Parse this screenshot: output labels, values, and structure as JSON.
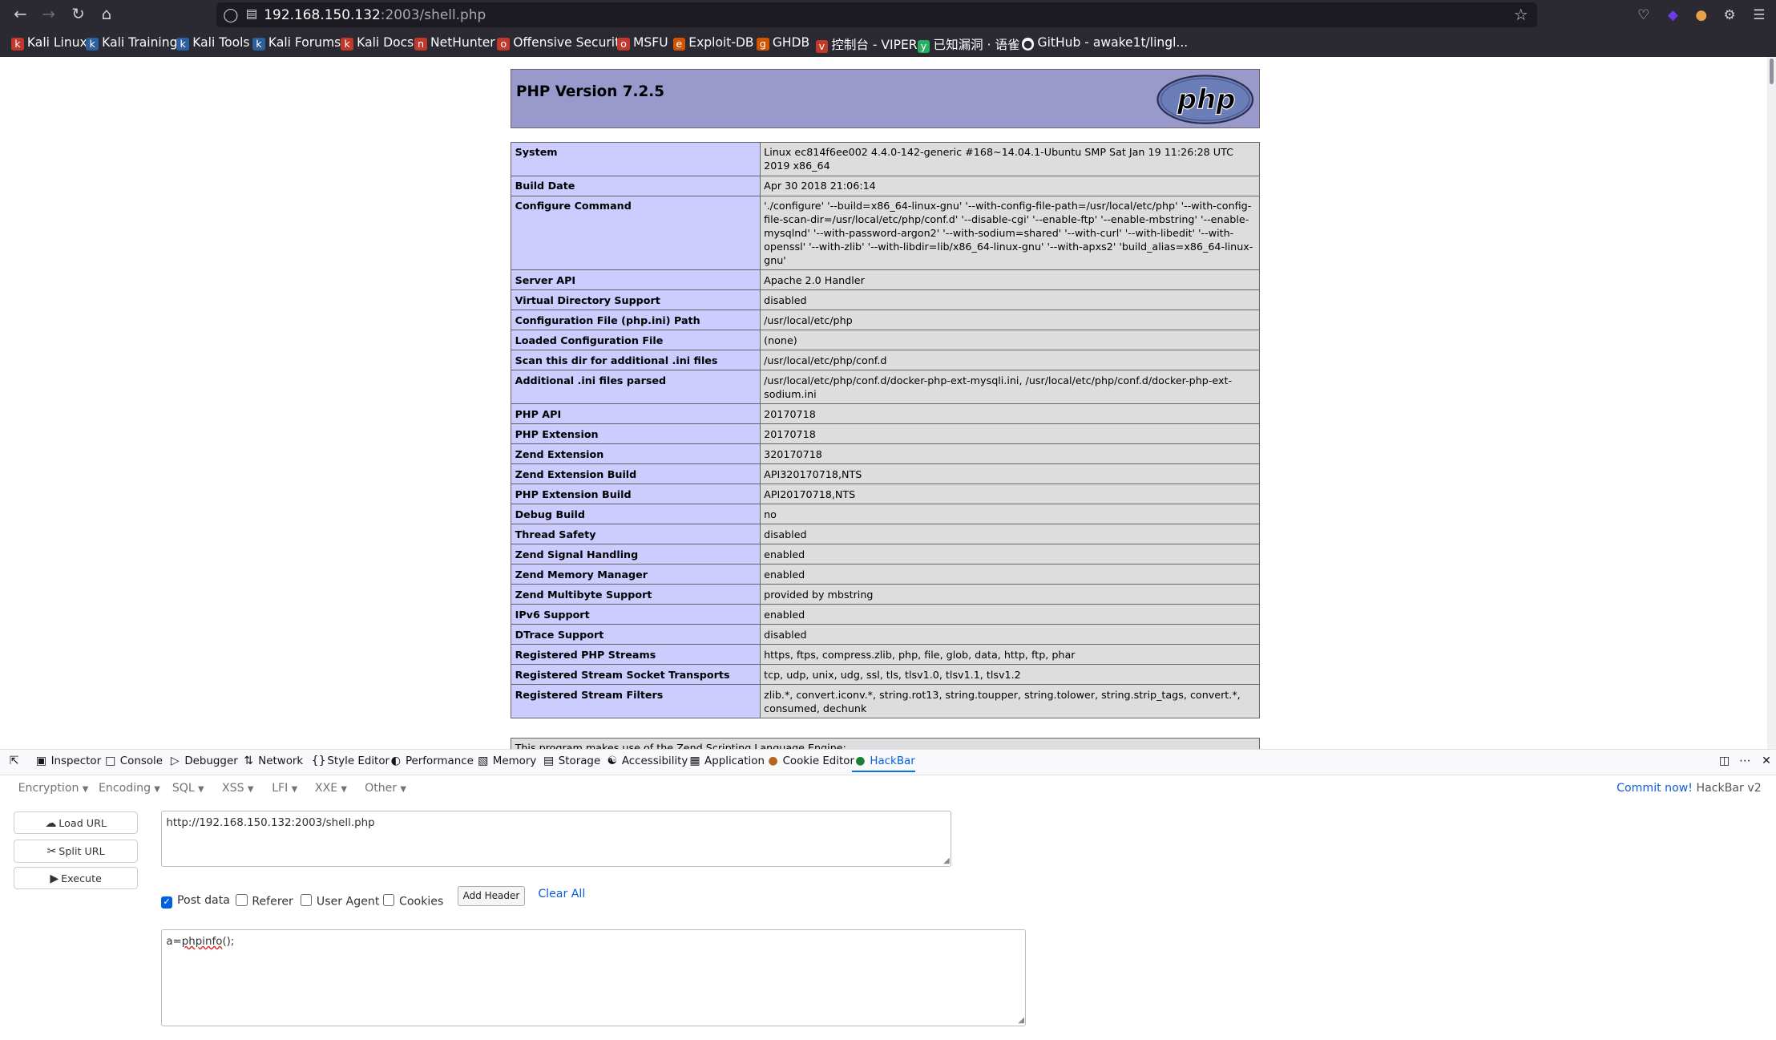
{
  "browser": {
    "url_host": "192.168.150.132",
    "url_path": ":2003/shell.php"
  },
  "bookmarks": [
    {
      "label": "Kali Linux"
    },
    {
      "label": "Kali Training"
    },
    {
      "label": "Kali Tools"
    },
    {
      "label": "Kali Forums"
    },
    {
      "label": "Kali Docs"
    },
    {
      "label": "NetHunter"
    },
    {
      "label": "Offensive Security"
    },
    {
      "label": "MSFU"
    },
    {
      "label": "Exploit-DB"
    },
    {
      "label": "GHDB"
    },
    {
      "label": "控制台 - VIPER"
    },
    {
      "label": "已知漏洞 · 语雀"
    },
    {
      "label": "GitHub - awake1t/lingl..."
    }
  ],
  "phpinfo": {
    "title": "PHP Version 7.2.5",
    "logo_text": "php",
    "rows": [
      {
        "k": "System",
        "v": "Linux ec814f6ee002 4.4.0-142-generic #168~14.04.1-Ubuntu SMP Sat Jan 19 11:26:28 UTC 2019 x86_64"
      },
      {
        "k": "Build Date",
        "v": "Apr 30 2018 21:06:14"
      },
      {
        "k": "Configure Command",
        "v": "'./configure' '--build=x86_64-linux-gnu' '--with-config-file-path=/usr/local/etc/php' '--with-config-file-scan-dir=/usr/local/etc/php/conf.d' '--disable-cgi' '--enable-ftp' '--enable-mbstring' '--enable-mysqlnd' '--with-password-argon2' '--with-sodium=shared' '--with-curl' '--with-libedit' '--with-openssl' '--with-zlib' '--with-libdir=lib/x86_64-linux-gnu' '--with-apxs2' 'build_alias=x86_64-linux-gnu'"
      },
      {
        "k": "Server API",
        "v": "Apache 2.0 Handler"
      },
      {
        "k": "Virtual Directory Support",
        "v": "disabled"
      },
      {
        "k": "Configuration File (php.ini) Path",
        "v": "/usr/local/etc/php"
      },
      {
        "k": "Loaded Configuration File",
        "v": "(none)"
      },
      {
        "k": "Scan this dir for additional .ini files",
        "v": "/usr/local/etc/php/conf.d"
      },
      {
        "k": "Additional .ini files parsed",
        "v": "/usr/local/etc/php/conf.d/docker-php-ext-mysqli.ini, /usr/local/etc/php/conf.d/docker-php-ext-sodium.ini"
      },
      {
        "k": "PHP API",
        "v": "20170718"
      },
      {
        "k": "PHP Extension",
        "v": "20170718"
      },
      {
        "k": "Zend Extension",
        "v": "320170718"
      },
      {
        "k": "Zend Extension Build",
        "v": "API320170718,NTS"
      },
      {
        "k": "PHP Extension Build",
        "v": "API20170718,NTS"
      },
      {
        "k": "Debug Build",
        "v": "no"
      },
      {
        "k": "Thread Safety",
        "v": "disabled"
      },
      {
        "k": "Zend Signal Handling",
        "v": "enabled"
      },
      {
        "k": "Zend Memory Manager",
        "v": "enabled"
      },
      {
        "k": "Zend Multibyte Support",
        "v": "provided by mbstring"
      },
      {
        "k": "IPv6 Support",
        "v": "enabled"
      },
      {
        "k": "DTrace Support",
        "v": "disabled"
      },
      {
        "k": "Registered PHP Streams",
        "v": "https, ftps, compress.zlib, php, file, glob, data, http, ftp, phar"
      },
      {
        "k": "Registered Stream Socket Transports",
        "v": "tcp, udp, unix, udg, ssl, tls, tlsv1.0, tlsv1.1, tlsv1.2"
      },
      {
        "k": "Registered Stream Filters",
        "v": "zlib.*, convert.iconv.*, string.rot13, string.toupper, string.tolower, string.strip_tags, convert.*, consumed, dechunk"
      }
    ],
    "zend_note": "This program makes use of the Zend Scripting Language Engine:"
  },
  "devtools": {
    "tabs": [
      "Inspector",
      "Console",
      "Debugger",
      "Network",
      "Style Editor",
      "Performance",
      "Memory",
      "Storage",
      "Accessibility",
      "Application",
      "Cookie Editor",
      "HackBar"
    ],
    "active_tab": "HackBar"
  },
  "hackbar": {
    "menus": [
      "Encoding",
      "Encoding",
      "SQL",
      "XSS",
      "LFI",
      "XXE",
      "Other"
    ],
    "commit_link": "Commit now!",
    "version": "HackBar v2",
    "load_url": "Load URL",
    "split_url": "Split URL",
    "execute": "Execute",
    "url_value": "http://192.168.150.132:2003/shell.php",
    "post_data_label": "Post data",
    "referer_label": "Referer",
    "user_agent_label": "User Agent",
    "cookies_label": "Cookies",
    "add_header": "Add Header",
    "clear_all": "Clear All",
    "post_prefix": "a=",
    "post_func": "phpinfo",
    "post_suffix": "();"
  }
}
